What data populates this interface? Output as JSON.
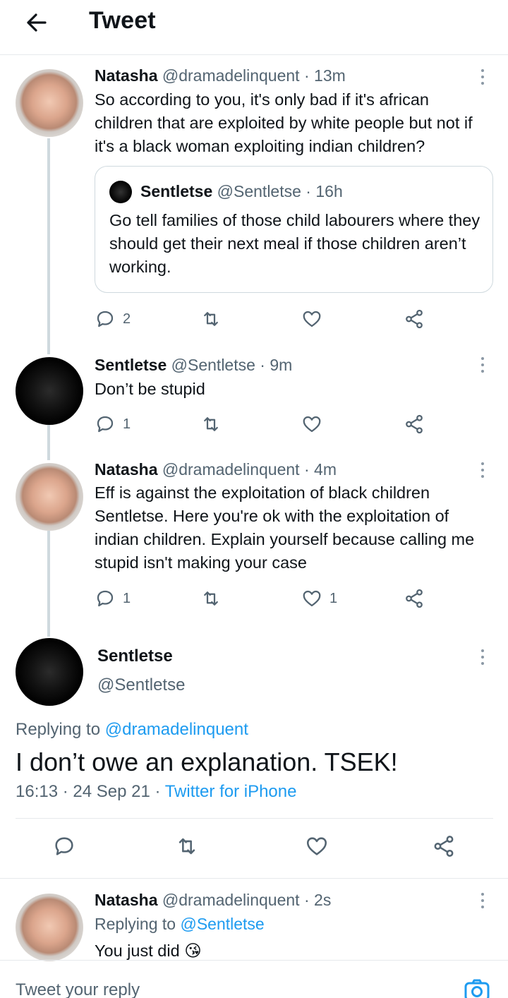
{
  "header": {
    "title": "Tweet",
    "back_icon": "arrow-left-icon"
  },
  "tweets": [
    {
      "name": "Natasha",
      "handle": "@dramadelinquent",
      "time": "13m",
      "text": "So according to you, it's only bad if it's african children that are exploited by white people but not if it's a black woman exploiting indian children?",
      "quote": {
        "name": "Sentletse",
        "handle": "@Sentletse",
        "time": "16h",
        "text": "Go tell families of those child labourers where they should get their next meal if those children aren’t working."
      },
      "reply_count": "2",
      "retweet_count": "",
      "like_count": ""
    },
    {
      "name": "Sentletse",
      "handle": "@Sentletse",
      "time": "9m",
      "text": "Don’t be stupid",
      "reply_count": "1",
      "retweet_count": "",
      "like_count": ""
    },
    {
      "name": "Natasha",
      "handle": "@dramadelinquent",
      "time": "4m",
      "text": "Eff is against the exploitation of black children Sentletse. Here you're ok with the exploitation of indian children. Explain yourself because calling me stupid isn't making your case",
      "reply_count": "1",
      "retweet_count": "",
      "like_count": "1"
    }
  ],
  "main_tweet": {
    "name": "Sentletse",
    "handle": "@Sentletse",
    "replying_label": "Replying to",
    "replying_to": "@dramadelinquent",
    "text": "I don’t owe an explanation. TSEK!",
    "timestamp": "16:13 · 24 Sep 21 · ",
    "source": "Twitter for iPhone"
  },
  "reply": {
    "name": "Natasha",
    "handle": "@dramadelinquent",
    "time": "2s",
    "replying_label": "Replying to",
    "replying_to": "@Sentletse",
    "text": "You just did",
    "emoji": "😘"
  },
  "composer": {
    "placeholder": "Tweet your reply",
    "camera_icon": "camera-icon"
  },
  "colors": {
    "link": "#1d9bf0",
    "secondary_text": "#536471",
    "thread_line": "#cfd9de"
  }
}
